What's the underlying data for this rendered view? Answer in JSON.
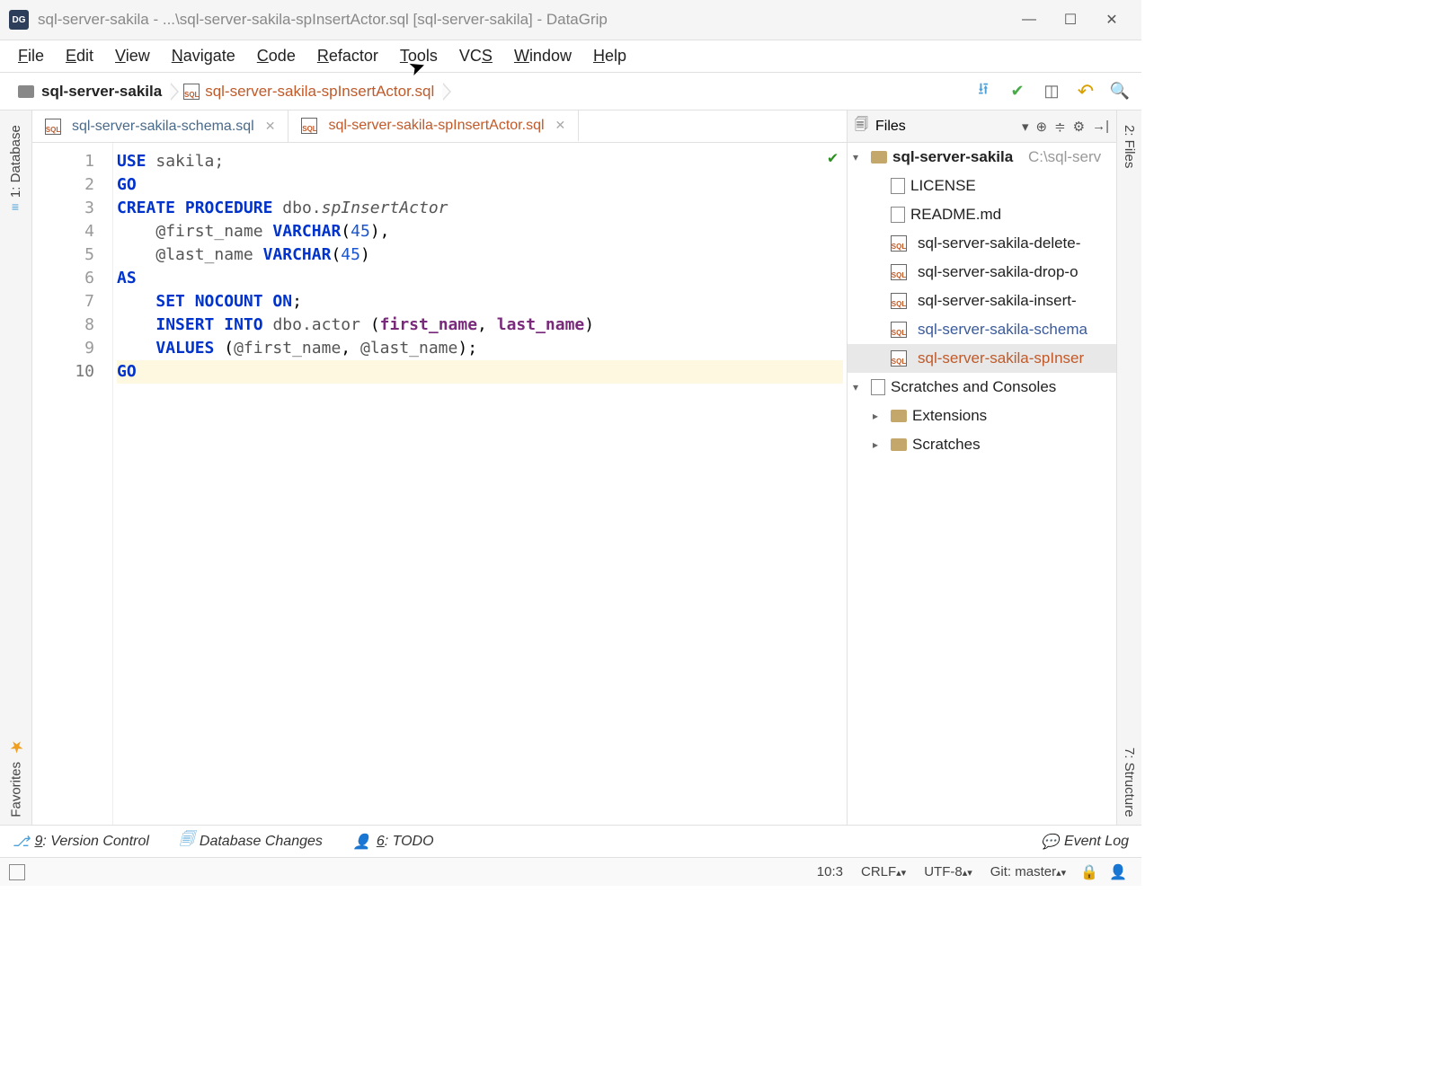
{
  "window": {
    "title": "sql-server-sakila - ...\\sql-server-sakila-spInsertActor.sql [sql-server-sakila] - DataGrip"
  },
  "menu": {
    "file": "File",
    "edit": "Edit",
    "view": "View",
    "navigate": "Navigate",
    "code": "Code",
    "refactor": "Refactor",
    "tools": "Tools",
    "vcs": "VCS",
    "window": "Window",
    "help": "Help"
  },
  "breadcrumb": {
    "project": "sql-server-sakila",
    "file": "sql-server-sakila-spInsertActor.sql"
  },
  "tabs": [
    {
      "label": "sql-server-sakila-schema.sql",
      "active": false
    },
    {
      "label": "sql-server-sakila-spInsertActor.sql",
      "active": true
    }
  ],
  "code": {
    "lines": [
      "1",
      "2",
      "3",
      "4",
      "5",
      "6",
      "7",
      "8",
      "9",
      "10"
    ],
    "tokens": {
      "use": "USE",
      "sakila": "sakila;",
      "go": "GO",
      "create": "CREATE",
      "procedure": "PROCEDURE",
      "dbo": "dbo.",
      "sp": "spInsertActor",
      "fn": "@first_name",
      "ln": "@last_name",
      "varchar": "VARCHAR",
      "v45": "45",
      "as": "AS",
      "set": "SET",
      "nocount": "NOCOUNT",
      "on": "ON",
      "insert": "INSERT",
      "into": "INTO",
      "actor": "dbo.actor",
      "fnc": "first_name",
      "lnc": "last_name",
      "values": "VALUES"
    }
  },
  "filesPanel": {
    "title": "Files",
    "root": {
      "name": "sql-server-sakila",
      "path": "C:\\sql-serv"
    },
    "files": [
      {
        "label": "LICENSE",
        "kind": "file"
      },
      {
        "label": "README.md",
        "kind": "file"
      },
      {
        "label": "sql-server-sakila-delete-",
        "kind": "sql"
      },
      {
        "label": "sql-server-sakila-drop-o",
        "kind": "sql"
      },
      {
        "label": "sql-server-sakila-insert-",
        "kind": "sql"
      },
      {
        "label": "sql-server-sakila-schema",
        "kind": "sql",
        "link": true
      },
      {
        "label": "sql-server-sakila-spInser",
        "kind": "sql",
        "selected": true
      }
    ],
    "scratches": "Scratches and Consoles",
    "extensions": "Extensions",
    "scratchesSub": "Scratches"
  },
  "sideTabs": {
    "database": "1: Database",
    "favorites": "Favorites",
    "files": "2: Files",
    "structure": "7: Structure"
  },
  "bottom": {
    "vc": "9: Version Control",
    "dbc": "Database Changes",
    "todo": "6: TODO",
    "eventLog": "Event Log"
  },
  "status": {
    "pos": "10:3",
    "eol": "CRLF",
    "enc": "UTF-8",
    "git": "Git: master"
  }
}
